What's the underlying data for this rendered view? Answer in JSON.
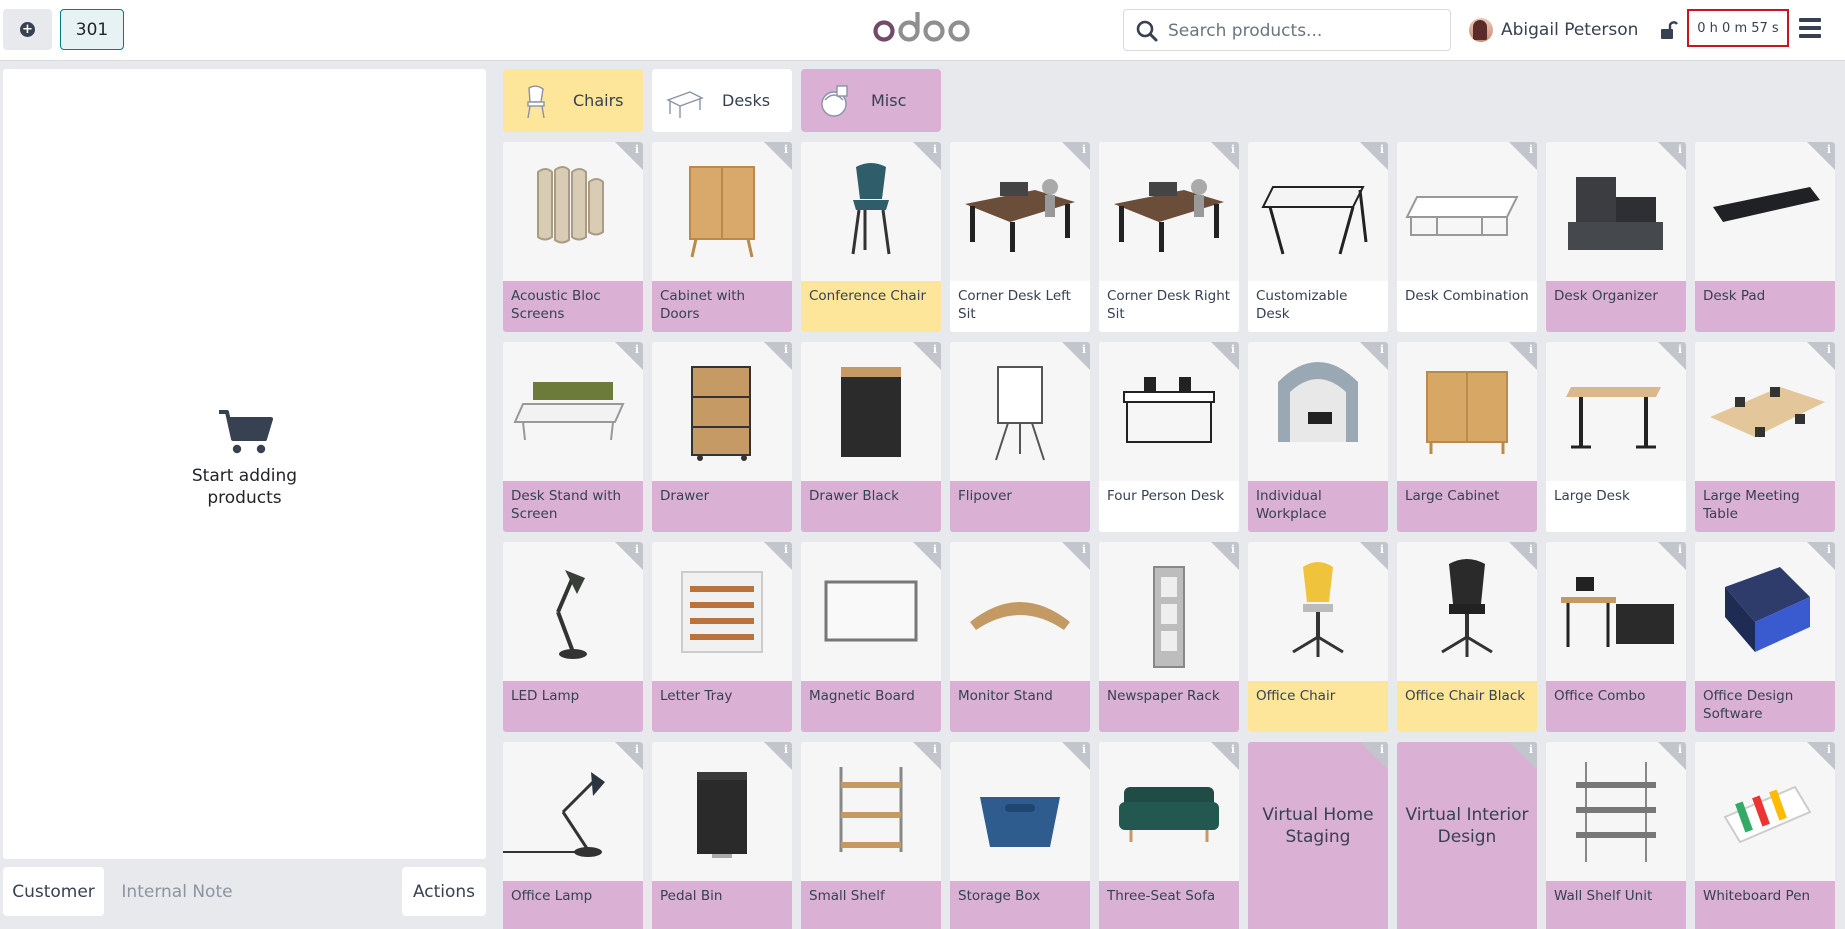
{
  "header": {
    "order_number": "301",
    "search_placeholder": "Search products...",
    "user_name": "Abigail Peterson",
    "timer": "0 h 0 m 57 s"
  },
  "order_panel": {
    "empty_message": "Start adding products"
  },
  "footer": {
    "customer": "Customer",
    "internal_note": "Internal Note",
    "actions": "Actions"
  },
  "categories": [
    {
      "label": "Chairs",
      "color": "#fde59a"
    },
    {
      "label": "Desks",
      "color": "#ffffff"
    },
    {
      "label": "Misc",
      "color": "#dab0d4"
    }
  ],
  "products": [
    {
      "name": "Acoustic Bloc Screens",
      "color": "pink",
      "icon": "acoustic-screens-image"
    },
    {
      "name": "Cabinet with Doors",
      "color": "pink",
      "icon": "cabinet-image"
    },
    {
      "name": "Conference Chair",
      "color": "yellow",
      "icon": "chair-image"
    },
    {
      "name": "Corner Desk Left Sit",
      "color": "white",
      "icon": "corner-desk-image"
    },
    {
      "name": "Corner Desk Right Sit",
      "color": "white",
      "icon": "corner-desk-image"
    },
    {
      "name": "Customizable Desk",
      "color": "white",
      "icon": "desk-image"
    },
    {
      "name": "Desk Combination",
      "color": "white",
      "icon": "desk-combination-image"
    },
    {
      "name": "Desk Organizer",
      "color": "pink",
      "icon": "desk-organizer-image"
    },
    {
      "name": "Desk Pad",
      "color": "pink",
      "icon": "desk-pad-image"
    },
    {
      "name": "Desk Stand with Screen",
      "color": "pink",
      "icon": "desk-stand-image"
    },
    {
      "name": "Drawer",
      "color": "pink",
      "icon": "drawer-image"
    },
    {
      "name": "Drawer Black",
      "color": "pink",
      "icon": "drawer-black-image"
    },
    {
      "name": "Flipover",
      "color": "pink",
      "icon": "flipover-image"
    },
    {
      "name": "Four Person Desk",
      "color": "white",
      "icon": "four-person-desk-image"
    },
    {
      "name": "Individual Workplace",
      "color": "pink",
      "icon": "workplace-pod-image"
    },
    {
      "name": "Large Cabinet",
      "color": "pink",
      "icon": "large-cabinet-image"
    },
    {
      "name": "Large Desk",
      "color": "white",
      "icon": "large-desk-image"
    },
    {
      "name": "Large Meeting Table",
      "color": "pink",
      "icon": "meeting-table-image"
    },
    {
      "name": "LED Lamp",
      "color": "pink",
      "icon": "lamp-image"
    },
    {
      "name": "Letter Tray",
      "color": "pink",
      "icon": "letter-tray-image"
    },
    {
      "name": "Magnetic Board",
      "color": "pink",
      "icon": "board-image"
    },
    {
      "name": "Monitor Stand",
      "color": "pink",
      "icon": "monitor-stand-image"
    },
    {
      "name": "Newspaper Rack",
      "color": "pink",
      "icon": "newspaper-rack-image"
    },
    {
      "name": "Office Chair",
      "color": "yellow",
      "icon": "office-chair-image"
    },
    {
      "name": "Office Chair Black",
      "color": "yellow",
      "icon": "office-chair-black-image"
    },
    {
      "name": "Office Combo",
      "color": "pink",
      "icon": "office-combo-image"
    },
    {
      "name": "Office Design Software",
      "color": "pink",
      "icon": "software-box-image"
    },
    {
      "name": "Office Lamp",
      "color": "pink",
      "icon": "office-lamp-image"
    },
    {
      "name": "Pedal Bin",
      "color": "pink",
      "icon": "pedal-bin-image"
    },
    {
      "name": "Small Shelf",
      "color": "pink",
      "icon": "small-shelf-image"
    },
    {
      "name": "Storage Box",
      "color": "pink",
      "icon": "storage-box-image"
    },
    {
      "name": "Three-Seat Sofa",
      "color": "pink",
      "icon": "sofa-image"
    },
    {
      "name": "Virtual Home Staging",
      "color": "pink",
      "icon": "none"
    },
    {
      "name": "Virtual Interior Design",
      "color": "pink",
      "icon": "none"
    },
    {
      "name": "Wall Shelf Unit",
      "color": "pink",
      "icon": "wall-shelf-image"
    },
    {
      "name": "Whiteboard Pen",
      "color": "pink",
      "icon": "whiteboard-pen-image"
    }
  ]
}
